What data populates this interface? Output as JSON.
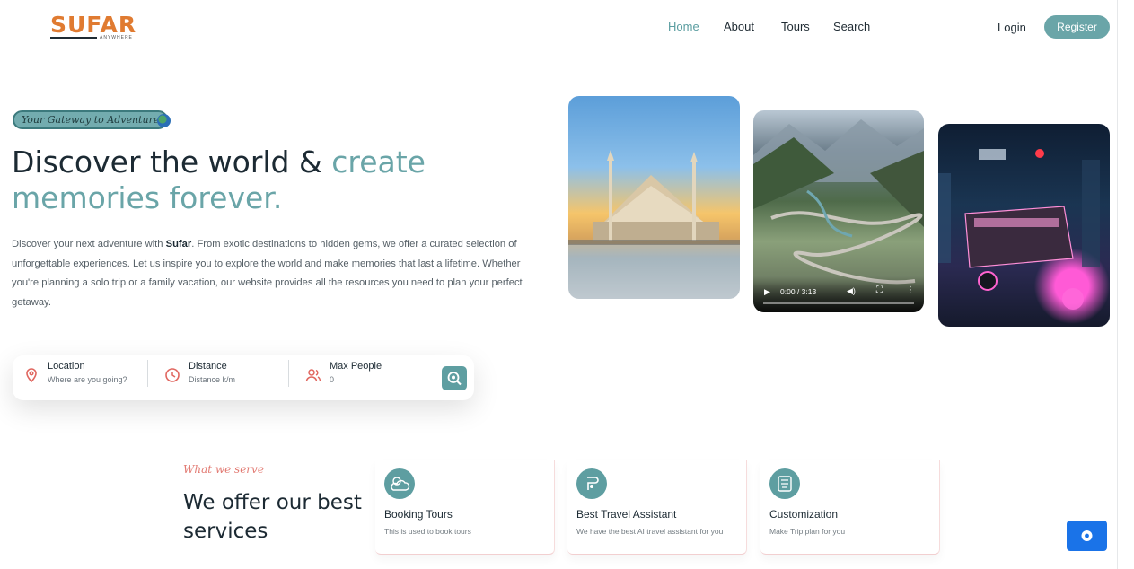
{
  "brand": {
    "name": "SUFAR",
    "tagline": "ANYWHERE",
    "color": "#e07b31"
  },
  "nav": {
    "items": [
      {
        "label": "Home",
        "active": true
      },
      {
        "label": "About"
      },
      {
        "label": "Tours"
      },
      {
        "label": "Search"
      }
    ],
    "login": "Login",
    "register": "Register"
  },
  "hero": {
    "badge": "Your Gateway to Adventure",
    "headline_main": "Discover the world & ",
    "headline_accent": "create memories forever.",
    "intro_before": "Discover your next adventure with ",
    "intro_brand": "Sufar",
    "intro_after": ". From exotic destinations to hidden gems, we offer a curated selection of unforgettable experiences. Let us inspire you to explore the world and make memories that last a lifetime. Whether you're planning a solo trip or a family vacation, our website provides all the resources you need to plan your perfect getaway."
  },
  "search": {
    "location": {
      "label": "Location",
      "placeholder": "Where are you going?",
      "icon": "location-pin-icon"
    },
    "distance": {
      "label": "Distance",
      "placeholder": "Distance k/m",
      "icon": "clock-icon"
    },
    "people": {
      "label": "Max People",
      "placeholder": "0",
      "icon": "people-icon"
    },
    "button_icon": "search-icon"
  },
  "video": {
    "time": "0:00 / 3:13",
    "progress": 0
  },
  "services": {
    "tag": "What we serve",
    "title": "We offer our best services",
    "items": [
      {
        "title": "Booking Tours",
        "desc": "This is used to book tours",
        "icon": "weather-icon"
      },
      {
        "title": "Best Travel Assistant",
        "desc": "We have the best AI travel assistant for you",
        "icon": "assistant-icon"
      },
      {
        "title": "Customization",
        "desc": "Make Trip plan for you",
        "icon": "customize-icon"
      }
    ]
  },
  "colors": {
    "accent": "#6aa5a8",
    "chat_button": "#1a73e8",
    "serve_tag": "#e27a72"
  }
}
